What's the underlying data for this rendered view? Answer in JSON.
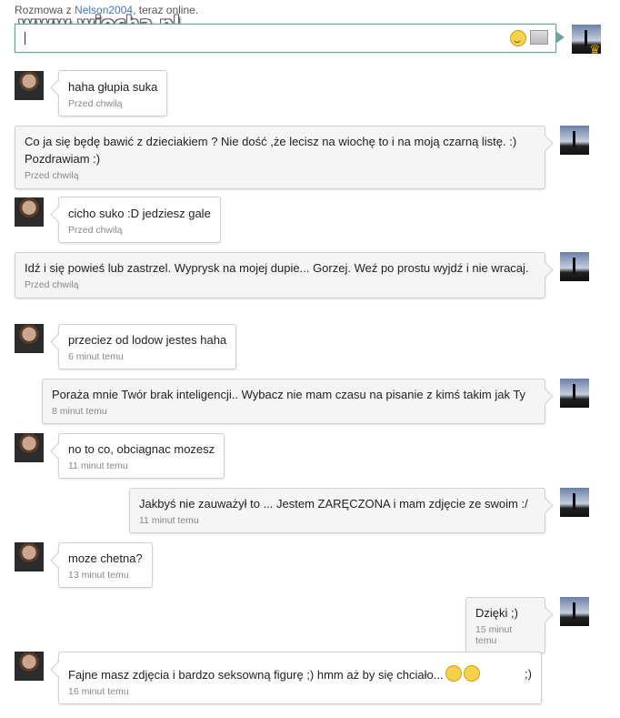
{
  "header": {
    "prefix": "Rozmowa z ",
    "username": "Nelson2004",
    "suffix": ", teraz online."
  },
  "watermark": "www.wiocha.pl",
  "composer": {
    "value": "",
    "emoji_icon": "smiley-icon",
    "image_icon": "image-icon"
  },
  "messages": [
    {
      "side": "in",
      "text": "haha głupia suka",
      "time": "Przed chwilą"
    },
    {
      "side": "out",
      "text": "Co ja się będę bawić z dzieciakiem ? Nie dość ,że lecisz na wiochę to i na moją czarną listę. :) Pozdrawiam :)",
      "time": "Przed chwilą"
    },
    {
      "side": "in",
      "text": "cicho suko :D jedziesz gale",
      "time": "Przed chwilą"
    },
    {
      "side": "out",
      "text": "Idź i się powieś lub zastrzel. Wyprysk na mojej dupie... Gorzej. Weź po prostu wyjdź i nie wracaj.",
      "time": "Przed chwilą"
    },
    {
      "side": "in",
      "text": "przeciez od lodow jestes haha",
      "time": "6 minut temu"
    },
    {
      "side": "out",
      "text": "Poraża mnie Twór brak inteligencji.. Wybacz nie mam czasu na pisanie z kimś takim jak Ty",
      "time": "8 minut temu"
    },
    {
      "side": "in",
      "text": "no to co, obciagnac mozesz",
      "time": "11 minut temu"
    },
    {
      "side": "out",
      "text": "Jakbyś nie zauważył to ... Jestem ZARĘCZONA i mam zdjęcie ze swoim :/",
      "time": "11 minut temu"
    },
    {
      "side": "in",
      "text": "moze chetna?",
      "time": "13 minut temu"
    },
    {
      "side": "out",
      "text": "Dzięki ;)",
      "time": "15 minut temu"
    },
    {
      "side": "in",
      "text": "Fajne masz zdjęcia i bardzo seksowną figurę ;) hmm aż by się chciało...",
      "text_end": ";)",
      "time": "16 minut temu"
    }
  ]
}
